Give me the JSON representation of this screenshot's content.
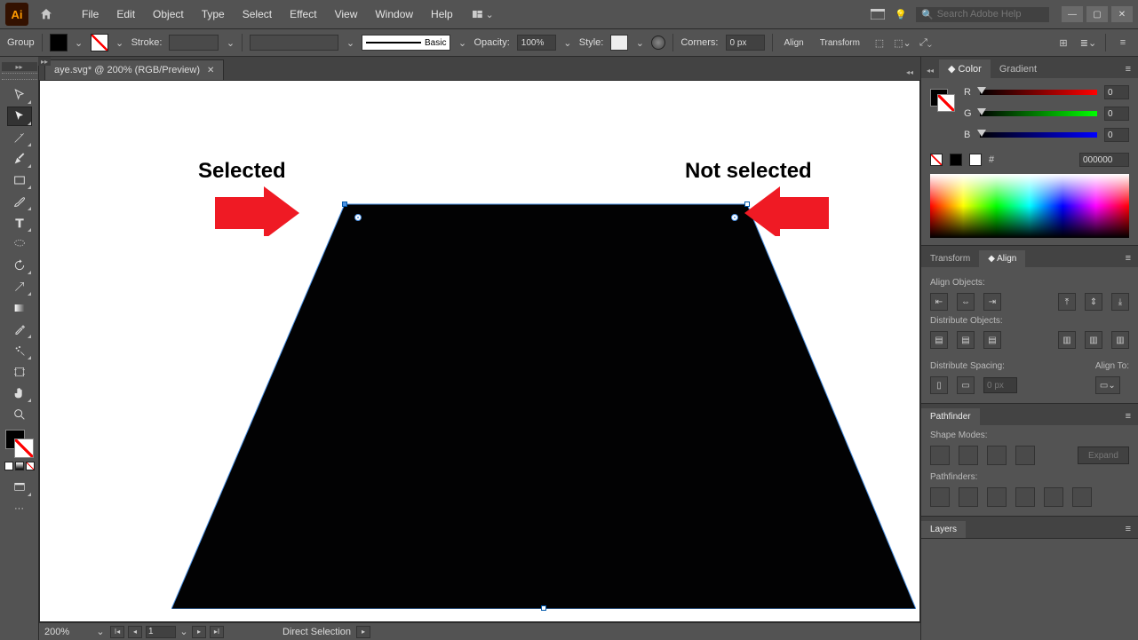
{
  "menu": {
    "items": [
      "File",
      "Edit",
      "Object",
      "Type",
      "Select",
      "Effect",
      "View",
      "Window",
      "Help"
    ],
    "search_placeholder": "Search Adobe Help"
  },
  "control": {
    "mode": "Group",
    "stroke_label": "Stroke:",
    "brush_label": "Basic",
    "opacity_label": "Opacity:",
    "opacity_value": "100%",
    "style_label": "Style:",
    "corners_label": "Corners:",
    "corners_value": "0 px",
    "align_label": "Align",
    "transform_label": "Transform"
  },
  "tab": {
    "title": "aye.svg* @ 200% (RGB/Preview)"
  },
  "canvas": {
    "selected_label": "Selected",
    "notselected_label": "Not selected"
  },
  "status": {
    "zoom": "200%",
    "artboard": "1",
    "tool": "Direct Selection"
  },
  "color": {
    "tab_color": "Color",
    "tab_gradient": "Gradient",
    "r": "0",
    "g": "0",
    "b": "0",
    "hex_prefix": "#",
    "hex": "000000"
  },
  "align": {
    "tab_transform": "Transform",
    "tab_align": "Align",
    "align_objects": "Align Objects:",
    "dist_objects": "Distribute Objects:",
    "dist_spacing": "Distribute Spacing:",
    "align_to": "Align To:",
    "spacing_value": "0 px"
  },
  "pathfinder": {
    "tab": "Pathfinder",
    "shape_modes": "Shape Modes:",
    "expand": "Expand",
    "pathfinders": "Pathfinders:"
  },
  "layers": {
    "tab": "Layers"
  }
}
